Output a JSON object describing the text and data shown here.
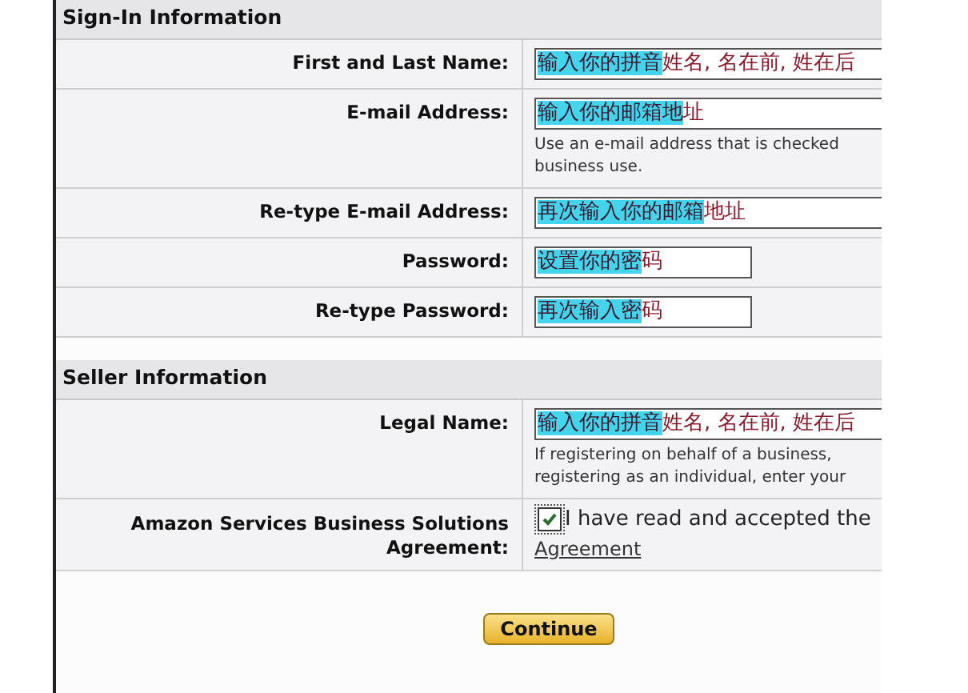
{
  "sections": [
    {
      "title": "Sign-In Information",
      "rows": [
        {
          "kind": "text",
          "label": "First and Last Name:",
          "value": [
            {
              "text": "输入你的拼音",
              "highlighted": true
            },
            {
              "text": "姓名, 名在前, 姓在后",
              "highlighted": false
            }
          ]
        },
        {
          "kind": "text",
          "label": "E-mail Address:",
          "value": [
            {
              "text": "输入你的邮箱地",
              "highlighted": true
            },
            {
              "text": "址",
              "highlighted": false
            }
          ],
          "hint_lines": [
            "Use an e-mail address that is checked",
            "business use."
          ]
        },
        {
          "kind": "text",
          "label": "Re-type E-mail Address:",
          "value": [
            {
              "text": "再次输入你的邮箱",
              "highlighted": true
            },
            {
              "text": "地址",
              "highlighted": false
            }
          ]
        },
        {
          "kind": "password",
          "label": "Password:",
          "value": [
            {
              "text": "设置你的密",
              "highlighted": true
            },
            {
              "text": "码",
              "highlighted": false
            }
          ]
        },
        {
          "kind": "password",
          "label": "Re-type Password:",
          "value": [
            {
              "text": "再次输入密",
              "highlighted": true
            },
            {
              "text": "码",
              "highlighted": false
            }
          ]
        }
      ]
    },
    {
      "title": "Seller Information",
      "rows": [
        {
          "kind": "text",
          "label": "Legal Name:",
          "value": [
            {
              "text": "输入你的拼音",
              "highlighted": true
            },
            {
              "text": "姓名, 名在前, 姓在后",
              "highlighted": false
            }
          ],
          "hint_lines": [
            "If registering on behalf of a business,",
            "registering as an individual, enter your"
          ]
        },
        {
          "kind": "checkbox",
          "label": "Amazon Services Business Solutions Agreement:",
          "checked": true,
          "text": "I have read and accepted the",
          "link": "Agreement"
        }
      ]
    }
  ],
  "button": "Continue"
}
